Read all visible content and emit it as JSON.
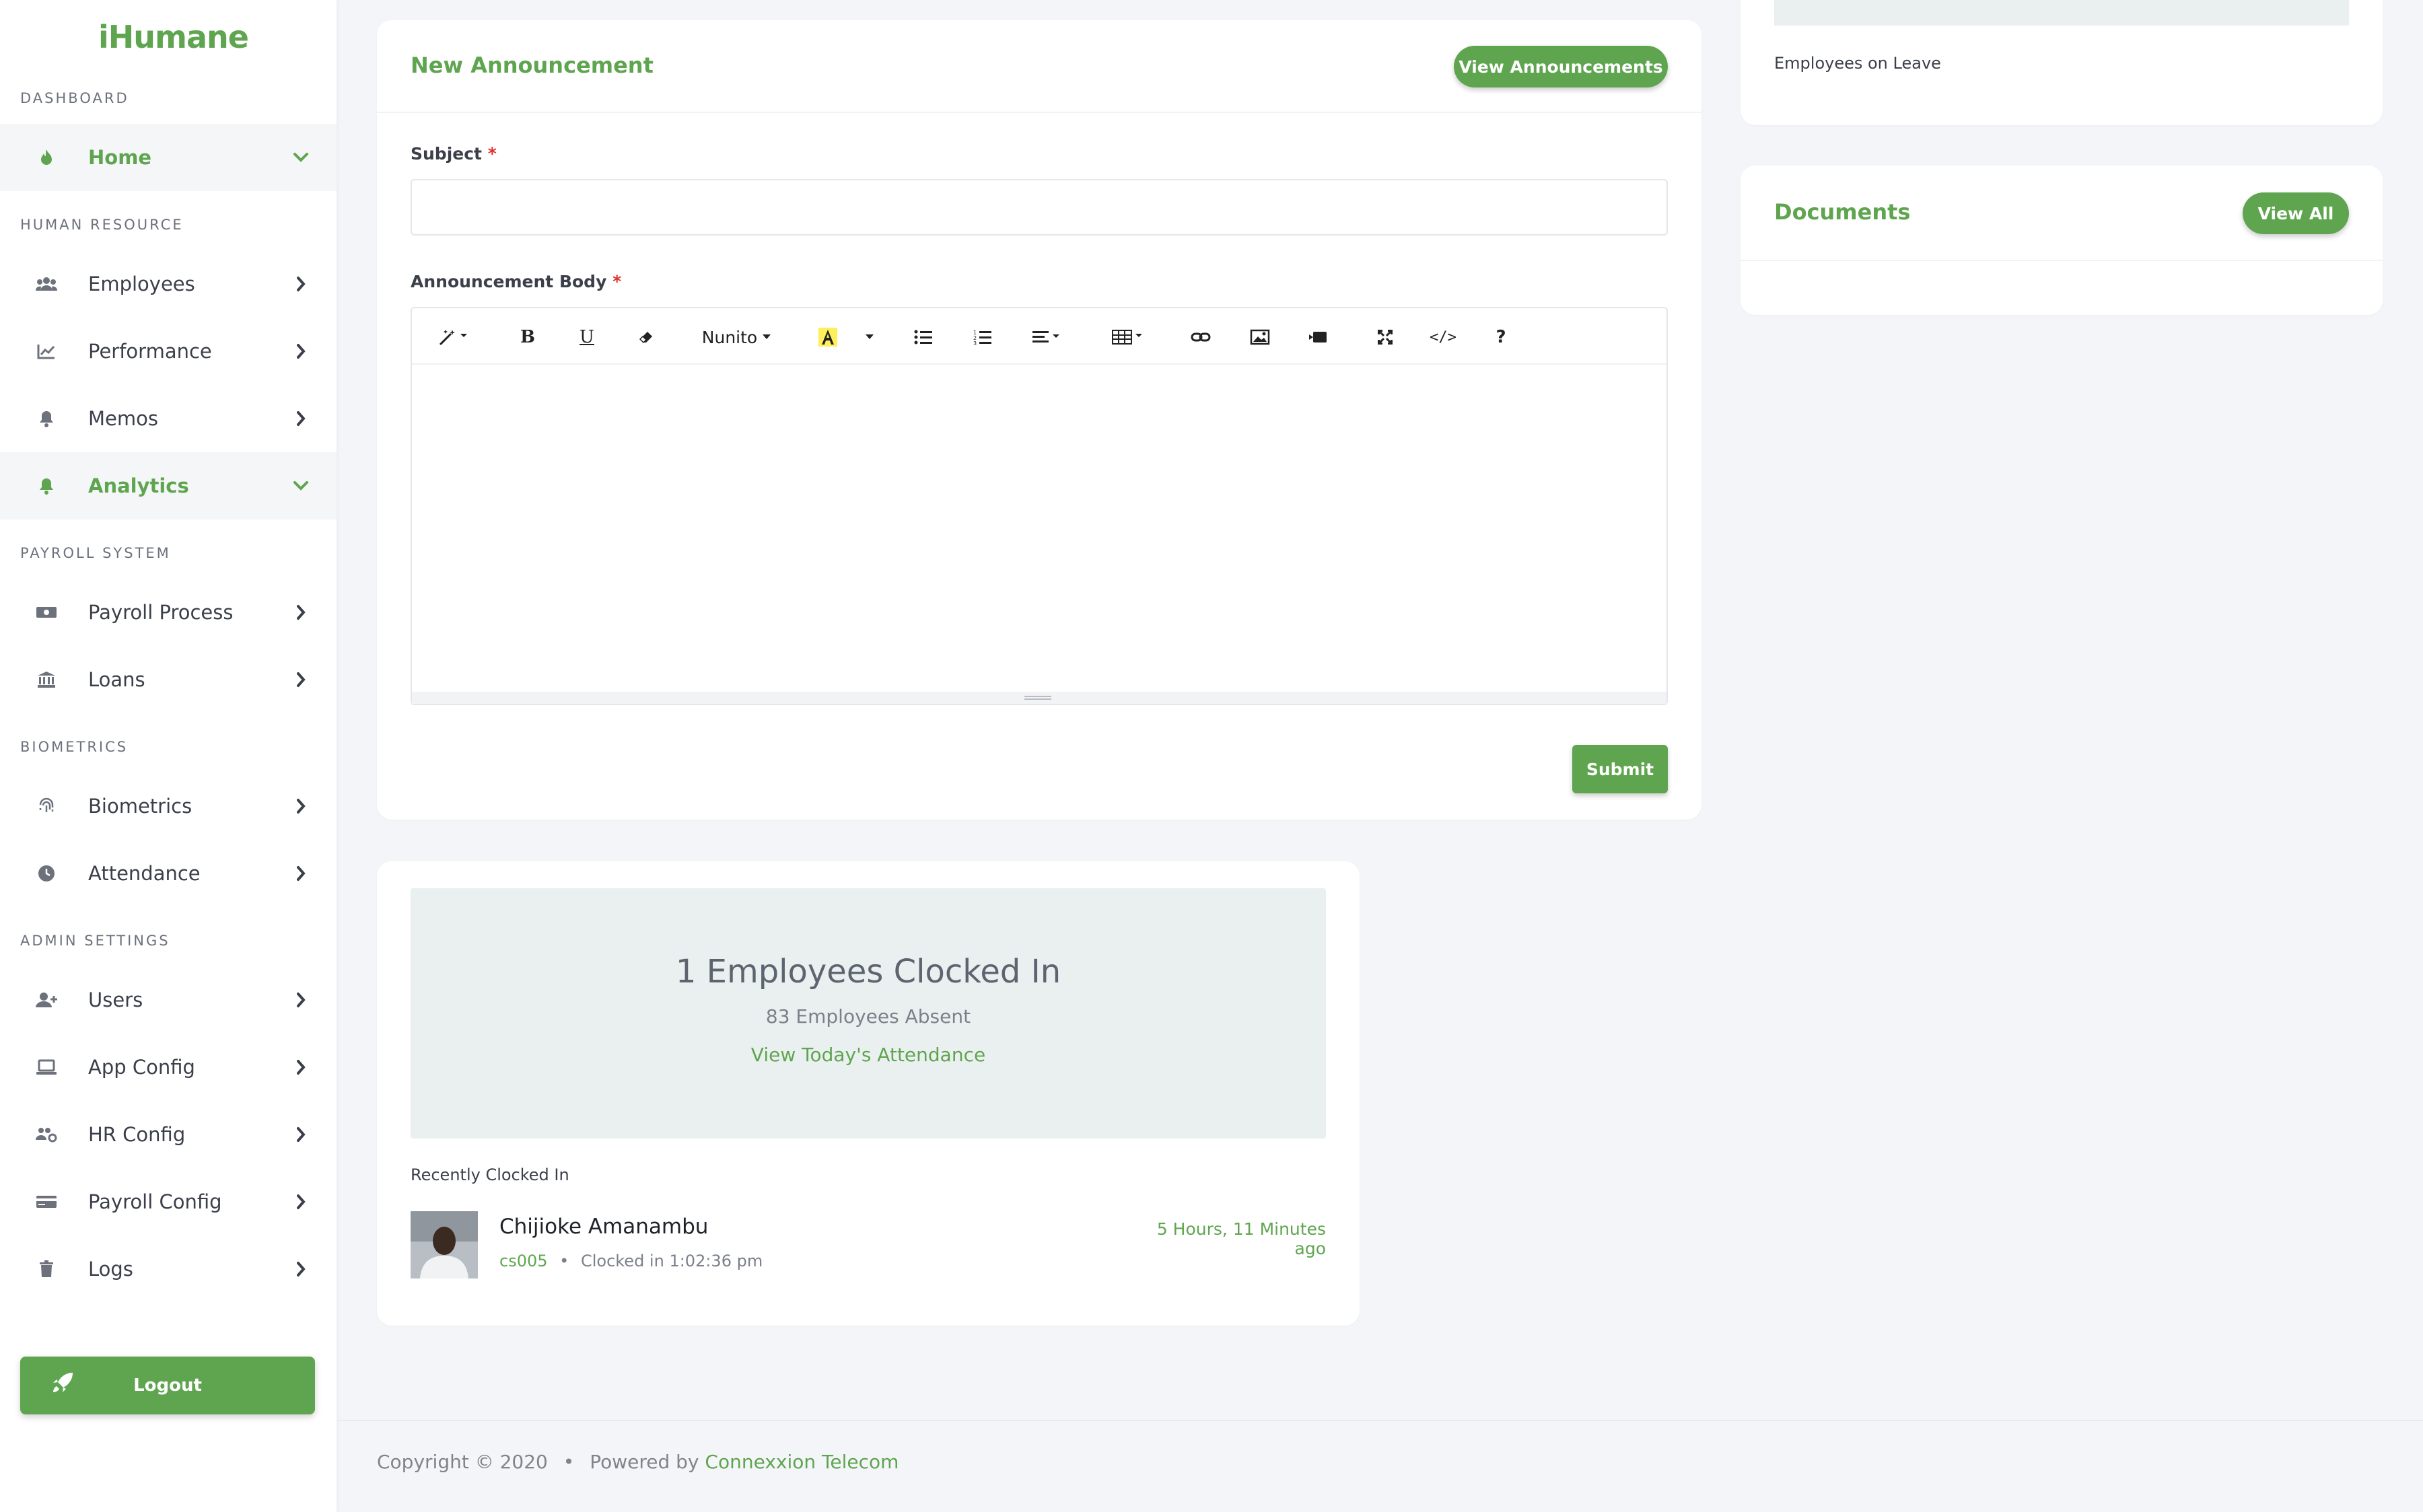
{
  "brand": {
    "logo_text": "iHumane",
    "accent": "#5fa54f"
  },
  "sidebar": {
    "sections": {
      "dashboard": "DASHBOARD",
      "human_resource": "HUMAN RESOURCE",
      "payroll_system": "PAYROLL SYSTEM",
      "biometrics": "BIOMETRICS",
      "admin_settings": "ADMIN SETTINGS"
    },
    "items": {
      "home": {
        "label": "Home",
        "icon": "fire-icon"
      },
      "employees": {
        "label": "Employees",
        "icon": "users-icon"
      },
      "performance": {
        "label": "Performance",
        "icon": "chart-line-icon"
      },
      "memos": {
        "label": "Memos",
        "icon": "bell-icon"
      },
      "analytics": {
        "label": "Analytics",
        "icon": "bell-icon"
      },
      "payroll_process": {
        "label": "Payroll Process",
        "icon": "money-icon"
      },
      "loans": {
        "label": "Loans",
        "icon": "bank-icon"
      },
      "biometrics": {
        "label": "Biometrics",
        "icon": "fingerprint-icon"
      },
      "attendance": {
        "label": "Attendance",
        "icon": "clock-icon"
      },
      "users": {
        "label": "Users",
        "icon": "user-plus-icon"
      },
      "app_config": {
        "label": "App Config",
        "icon": "laptop-icon"
      },
      "hr_config": {
        "label": "HR Config",
        "icon": "users-cog-icon"
      },
      "payroll_config": {
        "label": "Payroll Config",
        "icon": "credit-card-icon"
      },
      "logs": {
        "label": "Logs",
        "icon": "trash-icon"
      }
    },
    "logout_label": "Logout"
  },
  "announcement": {
    "title": "New Announcement",
    "view_button": "View Announcements",
    "subject_label": "Subject",
    "subject_value": "",
    "body_label": "Announcement Body",
    "required_mark": "*",
    "toolbar": {
      "font_name": "Nunito",
      "bold": "B",
      "underline": "U",
      "code_view": "</>",
      "help": "?"
    },
    "submit_label": "Submit"
  },
  "leave": {
    "label": "Employees on Leave"
  },
  "documents": {
    "title": "Documents",
    "view_all": "View All"
  },
  "attendance": {
    "clocked_in_headline": "1 Employees Clocked In",
    "absent_text": "83 Employees Absent",
    "view_link": "View Today's Attendance",
    "recent_label": "Recently Clocked In",
    "recent": {
      "name": "Chijioke Amanambu",
      "id": "cs005",
      "separator": "•",
      "clocked_text": "Clocked in 1:02:36 pm",
      "ago": "5 Hours, 11 Minutes ago"
    }
  },
  "footer": {
    "copyright": "Copyright © 2020",
    "separator": "•",
    "powered_by": "Powered by",
    "company": "Connexxion Telecom"
  }
}
